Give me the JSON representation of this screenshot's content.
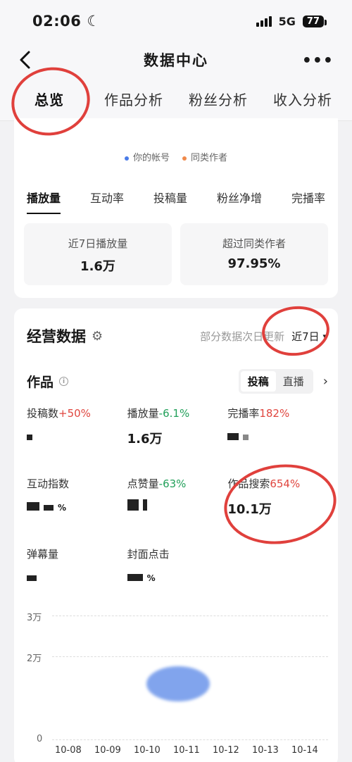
{
  "status_bar": {
    "time": "02:06",
    "network": "5G",
    "battery": "77"
  },
  "nav": {
    "back_icon": "back-icon",
    "title": "数据中心",
    "more_icon": "more-icon"
  },
  "tabs": [
    "总览",
    "作品分析",
    "粉丝分析",
    "收入分析"
  ],
  "overview_card": {
    "legend": [
      {
        "label": "你的帐号",
        "color": "#4a7be8"
      },
      {
        "label": "同类作者",
        "color": "#f08a4b"
      }
    ],
    "metric_tabs": [
      "播放量",
      "互动率",
      "投稿量",
      "粉丝净增",
      "完播率"
    ],
    "stats": [
      {
        "label": "近7日播放量",
        "value": "1.6万"
      },
      {
        "label": "超过同类作者",
        "value": "97.95%"
      }
    ]
  },
  "business": {
    "title": "经营数据",
    "note": "部分数据次日更新",
    "range": "近7日",
    "works_title": "作品",
    "segments": [
      "投稿",
      "直播"
    ],
    "metrics": [
      {
        "label": "投稿数",
        "delta": "+50%",
        "trend": "pos",
        "value": ""
      },
      {
        "label": "播放量",
        "delta": "-6.1%",
        "trend": "neg",
        "value": "1.6万"
      },
      {
        "label": "完播率",
        "delta": "182%",
        "trend": "pos",
        "value": ""
      },
      {
        "label": "互动指数",
        "delta": "",
        "trend": "",
        "value": "%"
      },
      {
        "label": "点赞量",
        "delta": "-63%",
        "trend": "neg",
        "value": ""
      },
      {
        "label": "作品搜索",
        "delta": "654%",
        "trend": "pos",
        "value": "10.1万"
      },
      {
        "label": "弹幕量",
        "delta": "",
        "trend": "",
        "value": ""
      },
      {
        "label": "封面点击",
        "delta": "",
        "trend": "",
        "value": "%"
      }
    ],
    "chart": {
      "y_ticks": [
        "3万",
        "2万",
        "0"
      ],
      "x_ticks": [
        "10-08",
        "10-09",
        "10-10",
        "10-11",
        "10-12",
        "10-13",
        "10-14"
      ]
    }
  }
}
